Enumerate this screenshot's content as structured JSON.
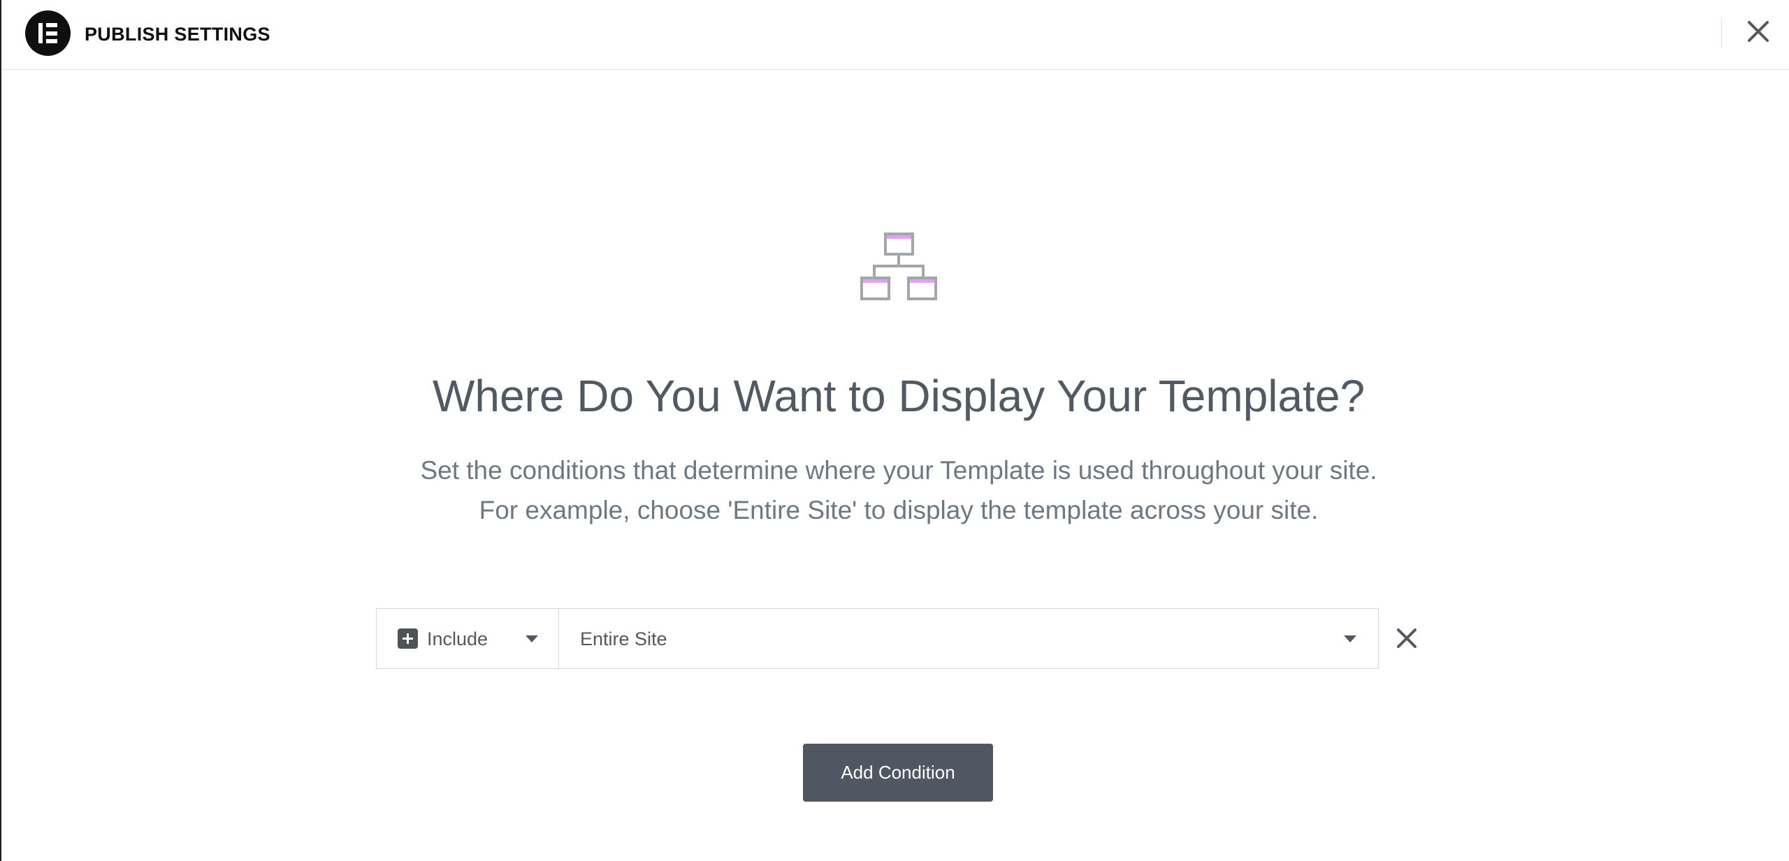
{
  "header": {
    "title": "PUBLISH SETTINGS",
    "logo_icon": "elementor-logo-icon",
    "close_icon": "close-icon"
  },
  "main": {
    "illustration_icon": "sitemap-icon",
    "title": "Where Do You Want to Display Your Template?",
    "subtitle_line1": "Set the conditions that determine where your Template is used throughout your site.",
    "subtitle_line2": "For example, choose 'Entire Site' to display the template across your site."
  },
  "condition": {
    "type_label": "Include",
    "type_icon": "plus-icon",
    "scope_label": "Entire Site",
    "remove_icon": "close-icon"
  },
  "actions": {
    "add_condition_label": "Add Condition"
  },
  "colors": {
    "accent_pink": "#e6a0f3",
    "button_bg": "#4f5862",
    "text_gray": "#515962"
  }
}
